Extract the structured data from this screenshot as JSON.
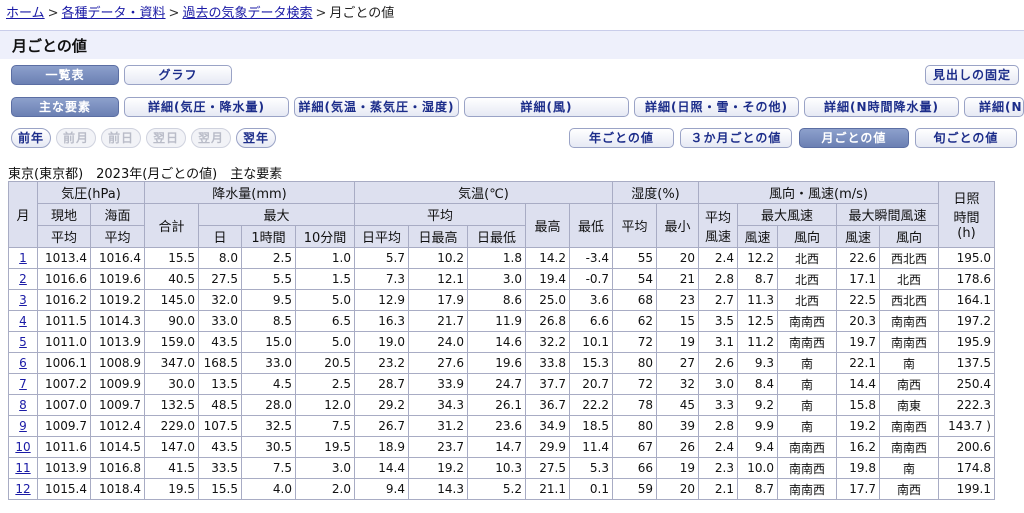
{
  "breadcrumb": [
    "ホーム",
    "各種データ・資料",
    "過去の気象データ検索"
  ],
  "breadcrumb_current": "月ごとの値",
  "page_title": "月ごとの値",
  "view_tabs": [
    "一覧表",
    "グラフ"
  ],
  "fix_header_button": "見出しの固定",
  "detail_tabs": [
    "主な要素",
    "詳細(気圧・降水量)",
    "詳細(気温・蒸気圧・湿度)",
    "詳細(風)",
    "詳細(日照・雪・その他)",
    "詳細(N時間降水量)",
    "詳細(N"
  ],
  "nav_buttons": [
    "前年",
    "前月",
    "前日",
    "翌日",
    "翌月",
    "翌年"
  ],
  "period_buttons": [
    "年ごとの値",
    "３か月ごとの値",
    "月ごとの値",
    "旬ごとの値"
  ],
  "caption": "東京(東京都)　2023年(月ごとの値)　主な要素",
  "table": {
    "h_month": "月",
    "h_pressure": "気圧(hPa)",
    "h_precip": "降水量(mm)",
    "h_temp": "気温(℃)",
    "h_humidity": "湿度(%)",
    "h_wind": "風向・風速(m/s)",
    "h_sun1": "日照",
    "h_sun2": "時間",
    "h_sun3": "(h)",
    "h_station": "現地",
    "h_sea": "海面",
    "h_total": "合計",
    "h_max": "最大",
    "h_avg": "平均",
    "h_highest": "最高",
    "h_lowest": "最低",
    "h_min": "最小",
    "h_wind_avg1": "平均",
    "h_wind_avg2": "風速",
    "h_maxwind": "最大風速",
    "h_gust": "最大瞬間風速",
    "h_day": "日",
    "h_1h": "1時間",
    "h_10m": "10分間",
    "h_daily_avg": "日平均",
    "h_daily_max": "日最高",
    "h_daily_min": "日最低",
    "h_speed": "風速",
    "h_dir": "風向",
    "rows": [
      [
        "1",
        "1013.4",
        "1016.4",
        "15.5",
        "8.0",
        "2.5",
        "1.0",
        "5.7",
        "10.2",
        "1.8",
        "14.2",
        "-3.4",
        "55",
        "20",
        "2.4",
        "12.2",
        "北西",
        "22.6",
        "西北西",
        "195.0"
      ],
      [
        "2",
        "1016.6",
        "1019.6",
        "40.5",
        "27.5",
        "5.5",
        "1.5",
        "7.3",
        "12.1",
        "3.0",
        "19.4",
        "-0.7",
        "54",
        "21",
        "2.8",
        "8.7",
        "北西",
        "17.1",
        "北西",
        "178.6"
      ],
      [
        "3",
        "1016.2",
        "1019.2",
        "145.0",
        "32.0",
        "9.5",
        "5.0",
        "12.9",
        "17.9",
        "8.6",
        "25.0",
        "3.6",
        "68",
        "23",
        "2.7",
        "11.3",
        "北西",
        "22.5",
        "西北西",
        "164.1"
      ],
      [
        "4",
        "1011.5",
        "1014.3",
        "90.0",
        "33.0",
        "8.5",
        "6.5",
        "16.3",
        "21.7",
        "11.9",
        "26.8",
        "6.6",
        "62",
        "15",
        "3.5",
        "12.5",
        "南南西",
        "20.3",
        "南南西",
        "197.2"
      ],
      [
        "5",
        "1011.0",
        "1013.9",
        "159.0",
        "43.5",
        "15.0",
        "5.0",
        "19.0",
        "24.0",
        "14.6",
        "32.2",
        "10.1",
        "72",
        "19",
        "3.1",
        "11.2",
        "南南西",
        "19.7",
        "南南西",
        "195.9"
      ],
      [
        "6",
        "1006.1",
        "1008.9",
        "347.0",
        "168.5",
        "33.0",
        "20.5",
        "23.2",
        "27.6",
        "19.6",
        "33.8",
        "15.3",
        "80",
        "27",
        "2.6",
        "9.3",
        "南",
        "22.1",
        "南",
        "137.5"
      ],
      [
        "7",
        "1007.2",
        "1009.9",
        "30.0",
        "13.5",
        "4.5",
        "2.5",
        "28.7",
        "33.9",
        "24.7",
        "37.7",
        "20.7",
        "72",
        "32",
        "3.0",
        "8.4",
        "南",
        "14.4",
        "南西",
        "250.4"
      ],
      [
        "8",
        "1007.0",
        "1009.7",
        "132.5",
        "48.5",
        "28.0",
        "12.0",
        "29.2",
        "34.3",
        "26.1",
        "36.7",
        "22.2",
        "78",
        "45",
        "3.3",
        "9.2",
        "南",
        "15.8",
        "南東",
        "222.3"
      ],
      [
        "9",
        "1009.7",
        "1012.4",
        "229.0",
        "107.5",
        "32.5",
        "7.5",
        "26.7",
        "31.2",
        "23.6",
        "34.9",
        "18.5",
        "80",
        "39",
        "2.8",
        "9.9",
        "南",
        "19.2",
        "南南西",
        "143.7 )"
      ],
      [
        "10",
        "1011.6",
        "1014.5",
        "147.0",
        "43.5",
        "30.5",
        "19.5",
        "18.9",
        "23.7",
        "14.7",
        "29.9",
        "11.4",
        "67",
        "26",
        "2.4",
        "9.4",
        "南南西",
        "16.2",
        "南南西",
        "200.6"
      ],
      [
        "11",
        "1013.9",
        "1016.8",
        "41.5",
        "33.5",
        "7.5",
        "3.0",
        "14.4",
        "19.2",
        "10.3",
        "27.5",
        "5.3",
        "66",
        "19",
        "2.3",
        "10.0",
        "南南西",
        "19.8",
        "南",
        "174.8"
      ],
      [
        "12",
        "1015.4",
        "1018.4",
        "19.5",
        "15.5",
        "4.0",
        "2.0",
        "9.4",
        "14.3",
        "5.2",
        "21.1",
        "0.1",
        "59",
        "20",
        "2.1",
        "8.7",
        "南南西",
        "17.7",
        "南西",
        "199.1"
      ]
    ]
  }
}
